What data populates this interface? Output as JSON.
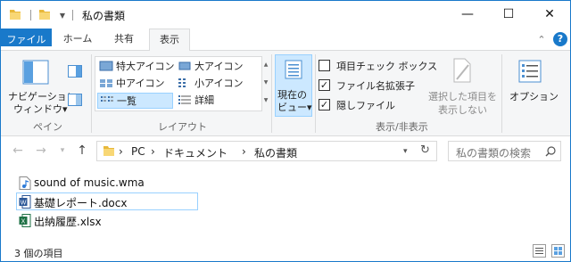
{
  "window": {
    "title": "私の書類",
    "controls": {
      "minimize": "—",
      "maximize": "☐",
      "close": "✕"
    }
  },
  "ribbon": {
    "tabs": [
      {
        "label": "ファイル"
      },
      {
        "label": "ホーム"
      },
      {
        "label": "共有"
      },
      {
        "label": "表示"
      }
    ],
    "active_tab": "表示",
    "pane_group": {
      "nav_pane_label_1": "ナビゲーション",
      "nav_pane_label_2": "ウィンドウ▾",
      "group_label": "ペイン"
    },
    "layout_group": {
      "items": [
        "特大アイコン",
        "大アイコン",
        "中アイコン",
        "小アイコン",
        "一覧",
        "詳細"
      ],
      "selected": "一覧",
      "group_label": "レイアウト"
    },
    "current_view": {
      "label_1": "現在の",
      "label_2": "ビュー▾"
    },
    "show_hide_group": {
      "checkboxes": [
        {
          "label": "項目チェック ボックス",
          "checked": false
        },
        {
          "label": "ファイル名拡張子",
          "checked": true
        },
        {
          "label": "隠しファイル",
          "checked": true
        }
      ],
      "hide_selected_1": "選択した項目を",
      "hide_selected_2": "表示しない",
      "group_label": "表示/非表示"
    },
    "options_label": "オプション"
  },
  "address_bar": {
    "breadcrumbs": [
      "PC",
      "ドキュメント",
      "私の書類"
    ],
    "separator": "›",
    "search_placeholder": "私の書類の検索"
  },
  "files": [
    {
      "name": "sound of music.wma",
      "icon": "audio-file-icon"
    },
    {
      "name": "基礎レポート.docx",
      "icon": "word-file-icon"
    },
    {
      "name": "出納履歴.xlsx",
      "icon": "excel-file-icon"
    }
  ],
  "selected_file": "基礎レポート.docx",
  "status": {
    "item_count": "3 個の項目"
  },
  "colors": {
    "accent": "#1979ca",
    "selection": "#cce8ff",
    "selection_border": "#99d1ff",
    "folder": "#f8d775"
  }
}
